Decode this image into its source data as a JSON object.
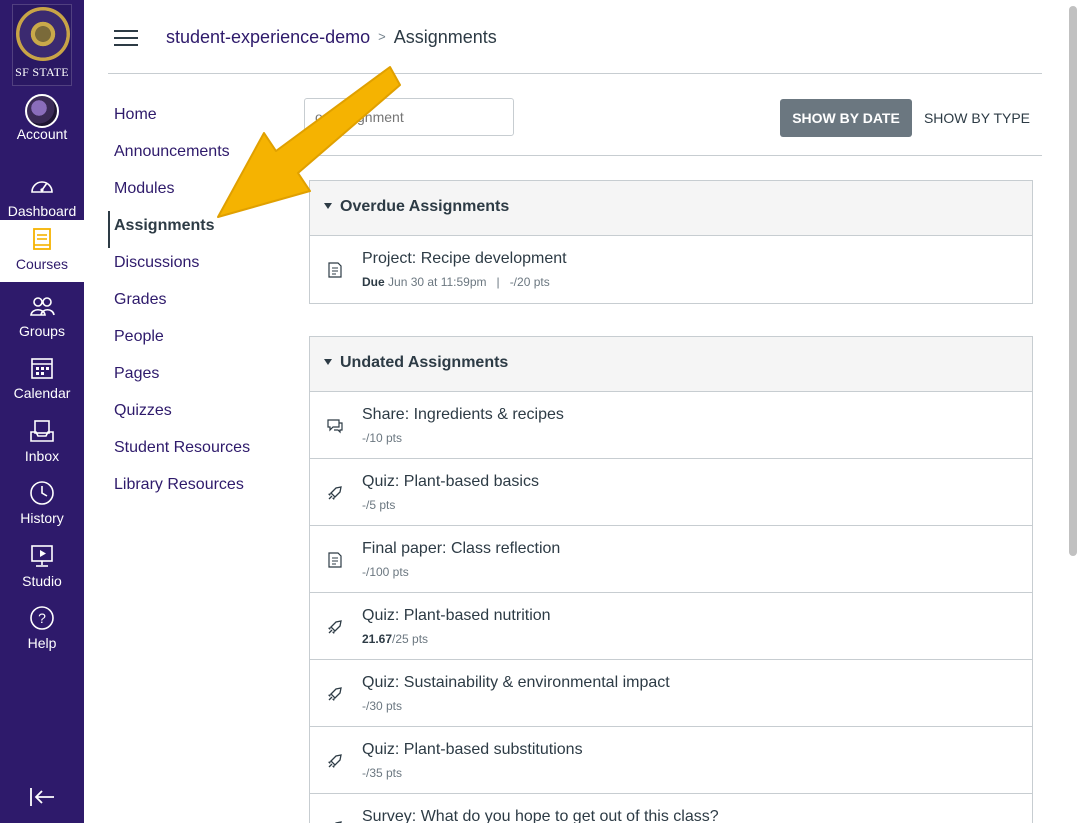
{
  "global_nav": {
    "logo_text": "SF STATE",
    "items": [
      {
        "label": "Account",
        "icon": "avatar"
      },
      {
        "label": "Dashboard",
        "icon": "dashboard-icon"
      },
      {
        "label": "Courses",
        "icon": "courses-icon",
        "active": true
      },
      {
        "label": "Groups",
        "icon": "groups-icon"
      },
      {
        "label": "Calendar",
        "icon": "calendar-icon"
      },
      {
        "label": "Inbox",
        "icon": "inbox-icon"
      },
      {
        "label": "History",
        "icon": "history-icon"
      },
      {
        "label": "Studio",
        "icon": "studio-icon"
      },
      {
        "label": "Help",
        "icon": "help-icon"
      }
    ],
    "collapse_icon": "collapse-nav-icon"
  },
  "header": {
    "breadcrumb_course": "student-experience-demo",
    "breadcrumb_separator": ">",
    "breadcrumb_current": "Assignments"
  },
  "course_nav": {
    "items": [
      {
        "label": "Home"
      },
      {
        "label": "Announcements"
      },
      {
        "label": "Modules"
      },
      {
        "label": "Assignments",
        "active": true
      },
      {
        "label": "Discussions"
      },
      {
        "label": "Grades"
      },
      {
        "label": "People"
      },
      {
        "label": "Pages"
      },
      {
        "label": "Quizzes"
      },
      {
        "label": "Student Resources"
      },
      {
        "label": "Library Resources"
      }
    ]
  },
  "toolbar": {
    "search_placeholder": "or Assignment",
    "show_by_date": "SHOW BY DATE",
    "show_by_type": "SHOW BY TYPE"
  },
  "groups": [
    {
      "title": "Overdue Assignments",
      "items": [
        {
          "icon": "assignment-icon",
          "title": "Project: Recipe development",
          "due_label": "Due",
          "due": "Jun 30 at 11:59pm",
          "sep": "|",
          "points": "-/20 pts"
        }
      ]
    },
    {
      "title": "Undated Assignments",
      "items": [
        {
          "icon": "discussion-icon",
          "title": "Share: Ingredients & recipes",
          "score": "",
          "points": "-/10 pts"
        },
        {
          "icon": "quiz-icon",
          "title": "Quiz: Plant-based basics",
          "score": "",
          "points": "-/5 pts"
        },
        {
          "icon": "assignment-icon",
          "title": "Final paper: Class reflection",
          "score": "",
          "points": "-/100 pts"
        },
        {
          "icon": "quiz-icon",
          "title": "Quiz: Plant-based nutrition",
          "score": "21.67",
          "points": "/25 pts"
        },
        {
          "icon": "quiz-icon",
          "title": "Quiz: Sustainability & environmental impact",
          "score": "",
          "points": "-/30 pts"
        },
        {
          "icon": "quiz-icon",
          "title": "Quiz: Plant-based substitutions",
          "score": "",
          "points": "-/35 pts"
        },
        {
          "icon": "quiz-icon",
          "title": "Survey: What do you hope to get out of this class?",
          "score": "",
          "points": ""
        }
      ]
    }
  ],
  "colors": {
    "nav_bg": "#2e1a6b",
    "link": "#2e1a6b",
    "arrow": "#f5b301",
    "button_bg": "#6b7780"
  }
}
